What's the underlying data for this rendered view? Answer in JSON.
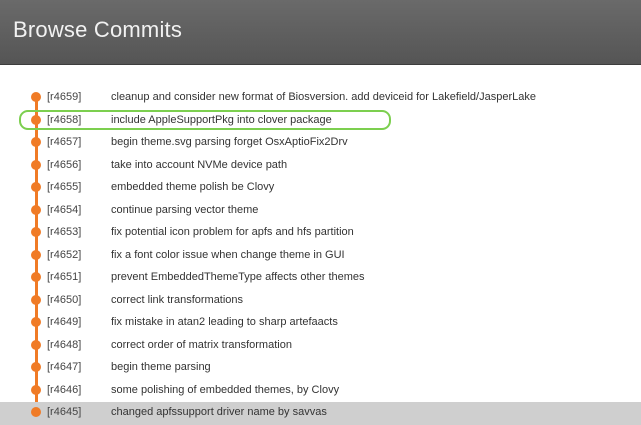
{
  "header": {
    "title": "Browse Commits"
  },
  "colors": {
    "accent": "#f07b26",
    "selection": "#7ccf4f",
    "header": "#5f5f5f",
    "hover": "#cfcfcf"
  },
  "commits": [
    {
      "rev": "[r4659]",
      "message": "cleanup and consider new format of Biosversion. add deviceid for Lakefield/JasperLake"
    },
    {
      "rev": "[r4658]",
      "message": "include AppleSupportPkg into clover package",
      "selected": true
    },
    {
      "rev": "[r4657]",
      "message": "begin theme.svg parsing forget OsxAptioFix2Drv"
    },
    {
      "rev": "[r4656]",
      "message": "take into account NVMe device path"
    },
    {
      "rev": "[r4655]",
      "message": "embedded theme polish be Clovy"
    },
    {
      "rev": "[r4654]",
      "message": "continue parsing vector theme"
    },
    {
      "rev": "[r4653]",
      "message": "fix potential icon problem for apfs and hfs partition"
    },
    {
      "rev": "[r4652]",
      "message": "fix a font color issue when change theme in GUI"
    },
    {
      "rev": "[r4651]",
      "message": "prevent EmbeddedThemeType affects other themes"
    },
    {
      "rev": "[r4650]",
      "message": "correct link transformations"
    },
    {
      "rev": "[r4649]",
      "message": "fix mistake in atan2 leading to sharp artefaacts"
    },
    {
      "rev": "[r4648]",
      "message": "correct order of matrix transformation"
    },
    {
      "rev": "[r4647]",
      "message": "begin theme parsing"
    },
    {
      "rev": "[r4646]",
      "message": "some polishing of embedded themes, by Clovy"
    },
    {
      "rev": "[r4645]",
      "message": "changed apfssupport driver name by savvas",
      "highlighted": true
    }
  ]
}
